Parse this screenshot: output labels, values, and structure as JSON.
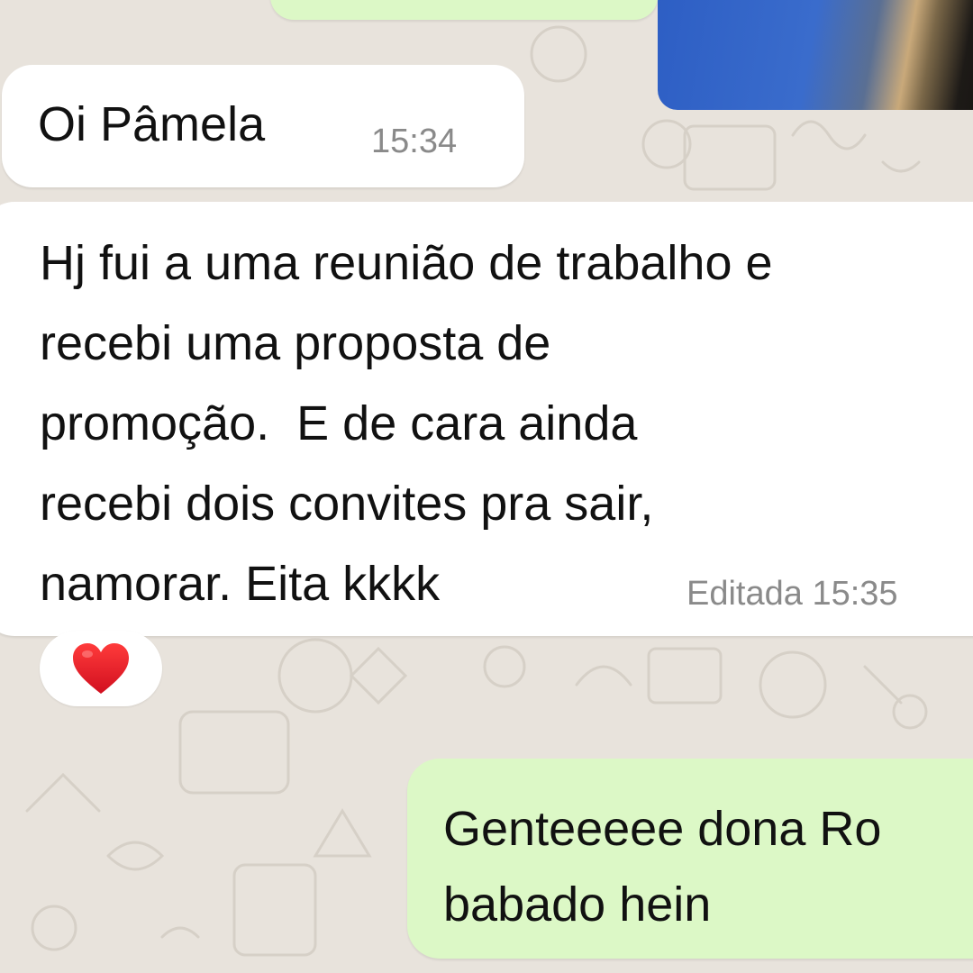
{
  "conversation": {
    "messages": [
      {
        "direction": "incoming",
        "text": "Oi Pâmela",
        "time": "15:34"
      },
      {
        "direction": "incoming",
        "lines": [
          "Hj fui a uma reunião de trabalho e",
          "recebi uma proposta de",
          "promoção.  E de cara ainda",
          "recebi dois convites pra sair,",
          "namorar. Eita kkkk"
        ],
        "edited_label": "Editada",
        "time": "15:35",
        "reaction": "❤️"
      },
      {
        "direction": "outgoing",
        "lines": [
          "Genteeeee dona Ro",
          "babado hein"
        ]
      }
    ]
  },
  "colors": {
    "background": "#e8e3dc",
    "incoming_bubble": "#ffffff",
    "outgoing_bubble": "#dcf8c6",
    "timestamp": "#8a8a8a"
  }
}
